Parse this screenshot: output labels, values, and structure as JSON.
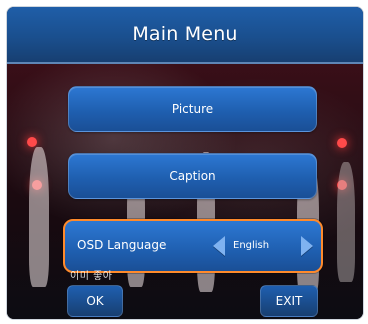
{
  "title": "Main Menu",
  "menu": {
    "picture_label": "Picture",
    "caption_label": "Caption",
    "osd_language": {
      "label": "OSD Language",
      "value": "English"
    }
  },
  "bottom_text": "이미 좋아",
  "keys": {
    "ok": "OK",
    "exit": "EXIT"
  },
  "colors": {
    "title_bar": "#1f5ea8",
    "button_blue": "#2d78d3",
    "selection_outline": "#ff8a2c",
    "arrow": "#7fb2f0"
  }
}
